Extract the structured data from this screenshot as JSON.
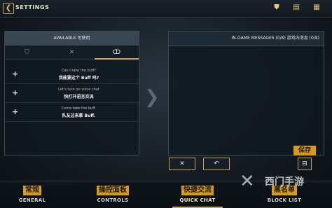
{
  "header": {
    "title": "SETTINGS",
    "back_icon": "back-arrow-icon",
    "icons": [
      "badge-icon",
      "chat-bubble-icon",
      "grid-menu-icon"
    ]
  },
  "available_panel": {
    "title": "AVAILABLE  可使用",
    "tabs": [
      {
        "icon": "shield-icon",
        "glyph": "⛉"
      },
      {
        "icon": "crossed-swords-icon",
        "glyph": "✕"
      },
      {
        "icon": "emote-icon",
        "glyph": "ↀ"
      }
    ],
    "items": [
      {
        "en": "Can I take the buff?",
        "zh": "我能要这个 Buff 吗?"
      },
      {
        "en": "Let's turn on voice chat",
        "zh": "快打开语言交流"
      },
      {
        "en": "Come take the buff.",
        "zh": "队友过来拿 Buff."
      }
    ]
  },
  "ingame_panel": {
    "title": "IN-GAME MESSAGES (0/8)  游戏内消息 (0/8)"
  },
  "actions": {
    "delete_glyph": "✕",
    "undo_glyph": "↶",
    "save_label": "保存",
    "save_glyph": "⊟"
  },
  "bottom_nav": [
    {
      "zh": "常规",
      "en": "GENERAL"
    },
    {
      "zh": "操控面板",
      "en": "CONTROLS"
    },
    {
      "zh": "快捷交流",
      "en": "QUICK CHAT"
    },
    {
      "zh": "黑名单",
      "en": "BLOCK LIST"
    }
  ],
  "watermark": {
    "text": "西门手游"
  },
  "colors": {
    "accent_gold": "#c7a35a",
    "tag_orange": "#d79a19"
  }
}
